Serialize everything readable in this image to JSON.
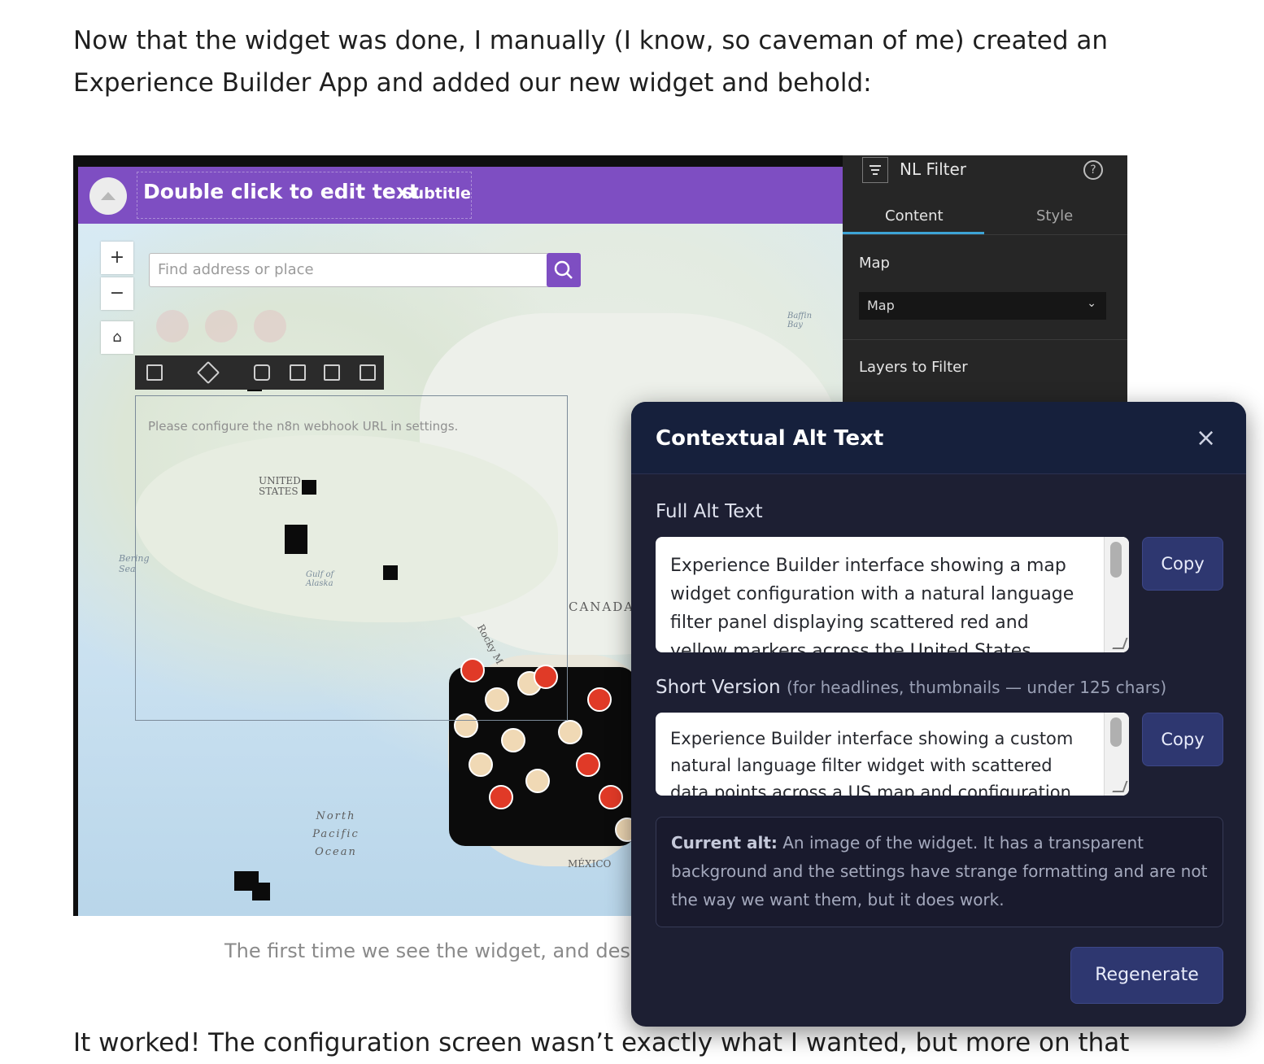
{
  "article": {
    "para_top": "Now that the widget was done, I manually (I know, so caveman of me) created an Experience Builder App and added our new widget and behold:",
    "para_bottom": "It worked! The configuration screen wasn’t exactly what I wanted, but more on that",
    "caption": "The first time we see the widget, and desp"
  },
  "screenshot": {
    "header_title": "Double click to edit text",
    "header_subtitle": "Subtitle",
    "zoom_in": "+",
    "zoom_out": "−",
    "home_icon": "home-icon",
    "search_placeholder": "Find address or place",
    "widget_message": "Please configure the n8n webhook URL in settings.",
    "map_labels": {
      "united_states": "UNITED STATES",
      "canada": "CANADA",
      "mexico": "MÉXICO",
      "ocean": "North Pacific Ocean",
      "bering": "Bering Sea",
      "gulf": "Gulf of Alaska",
      "baffin": "Baffin Bay",
      "rocky": "Rocky M"
    },
    "settings_panel": {
      "title": "NL Filter",
      "tab_content": "Content",
      "tab_style": "Style",
      "map_label": "Map",
      "map_select_value": "Map",
      "layers_label": "Layers to Filter"
    }
  },
  "dialog": {
    "title": "Contextual Alt Text",
    "close_icon": "close-icon",
    "full_label": "Full Alt Text",
    "full_text": "Experience Builder interface showing a map widget configuration with a natural language filter panel displaying scattered red and yellow markers across the United States, alongside a",
    "copy_label": "Copy",
    "short_label": "Short Version",
    "short_hint": "(for headlines, thumbnails — under 125 chars)",
    "short_text": "Experience Builder interface showing a custom natural language filter widget with scattered data points across a US map and configuration panel",
    "current_prefix": "Current alt:",
    "current_text": "An image of the widget. It has a transparent background and the settings have strange formatting and are not the way we want them, but it does work.",
    "regenerate_label": "Regenerate"
  },
  "colors": {
    "header_purple": "#7e4ec2",
    "dialog_bg": "#1d1f33",
    "button_bg": "#2e3770"
  }
}
